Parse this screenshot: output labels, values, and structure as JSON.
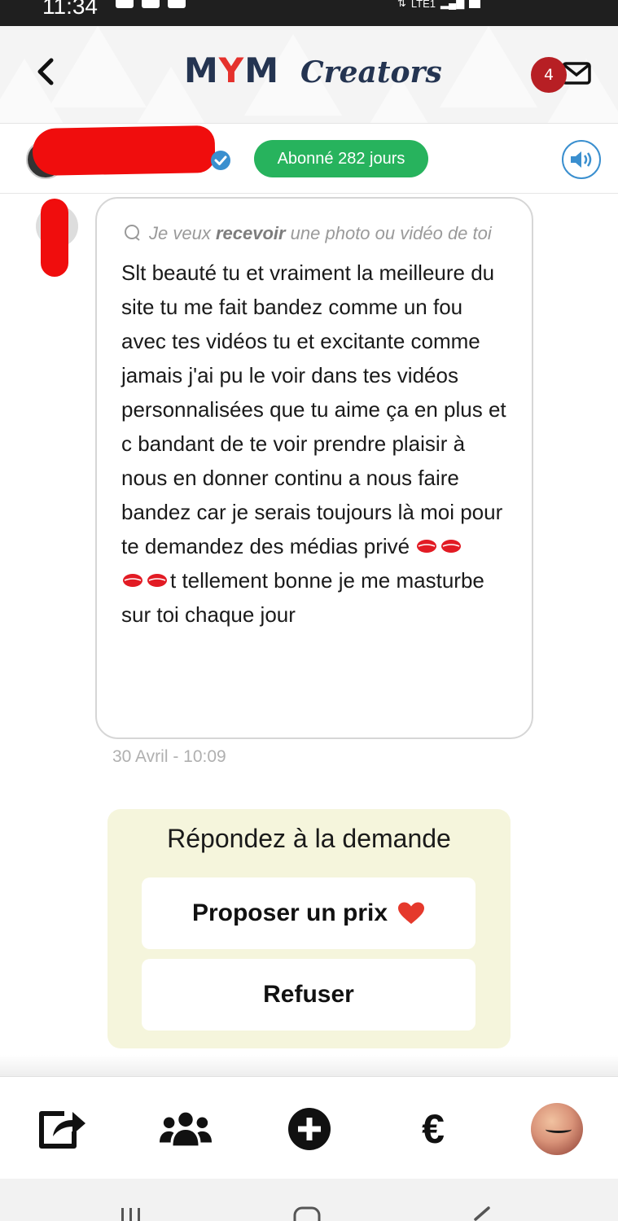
{
  "status_bar": {
    "time": "11:34",
    "network": "LTE1"
  },
  "header": {
    "logo_main": "MYM",
    "logo_sub": "Creators",
    "unread_count": "4"
  },
  "subscriber": {
    "badge": "Abonné 282 jours"
  },
  "message": {
    "request_prefix": "Je veux ",
    "request_bold": "recevoir",
    "request_suffix": " une photo ou vidéo de toi",
    "text_part1": "Slt beauté tu et vraiment la meilleure du site tu me fait bandez comme un fou avec tes vidéos tu et excitante comme jamais j'ai pu le voir dans tes vidéos personnalisées que tu aime ça en plus et c bandant de te voir prendre plaisir à nous en donner continu a nous faire bandez car je serais toujours là moi pour te demandez des médias privé ",
    "text_part2": "t tellement bonne je me masturbe sur toi chaque jour",
    "emoji_name": "kiss-mark-icon",
    "timestamp": "30 Avril - 10:09"
  },
  "reply": {
    "title": "Répondez à la demande",
    "propose_label": "Proposer un prix",
    "refuse_label": "Refuser"
  },
  "bottom_nav": {
    "items": [
      {
        "icon": "share-icon"
      },
      {
        "icon": "users-icon"
      },
      {
        "icon": "add-circle-icon"
      },
      {
        "icon": "euro-icon",
        "label": "€"
      },
      {
        "icon": "profile-avatar"
      }
    ]
  },
  "colors": {
    "brand_navy": "#243451",
    "brand_red": "#e5312c",
    "subscriber_green": "#27b35d",
    "badge_red": "#b71f24",
    "reply_bg": "#f5f5dc",
    "sound_blue": "#3a8fcf"
  }
}
